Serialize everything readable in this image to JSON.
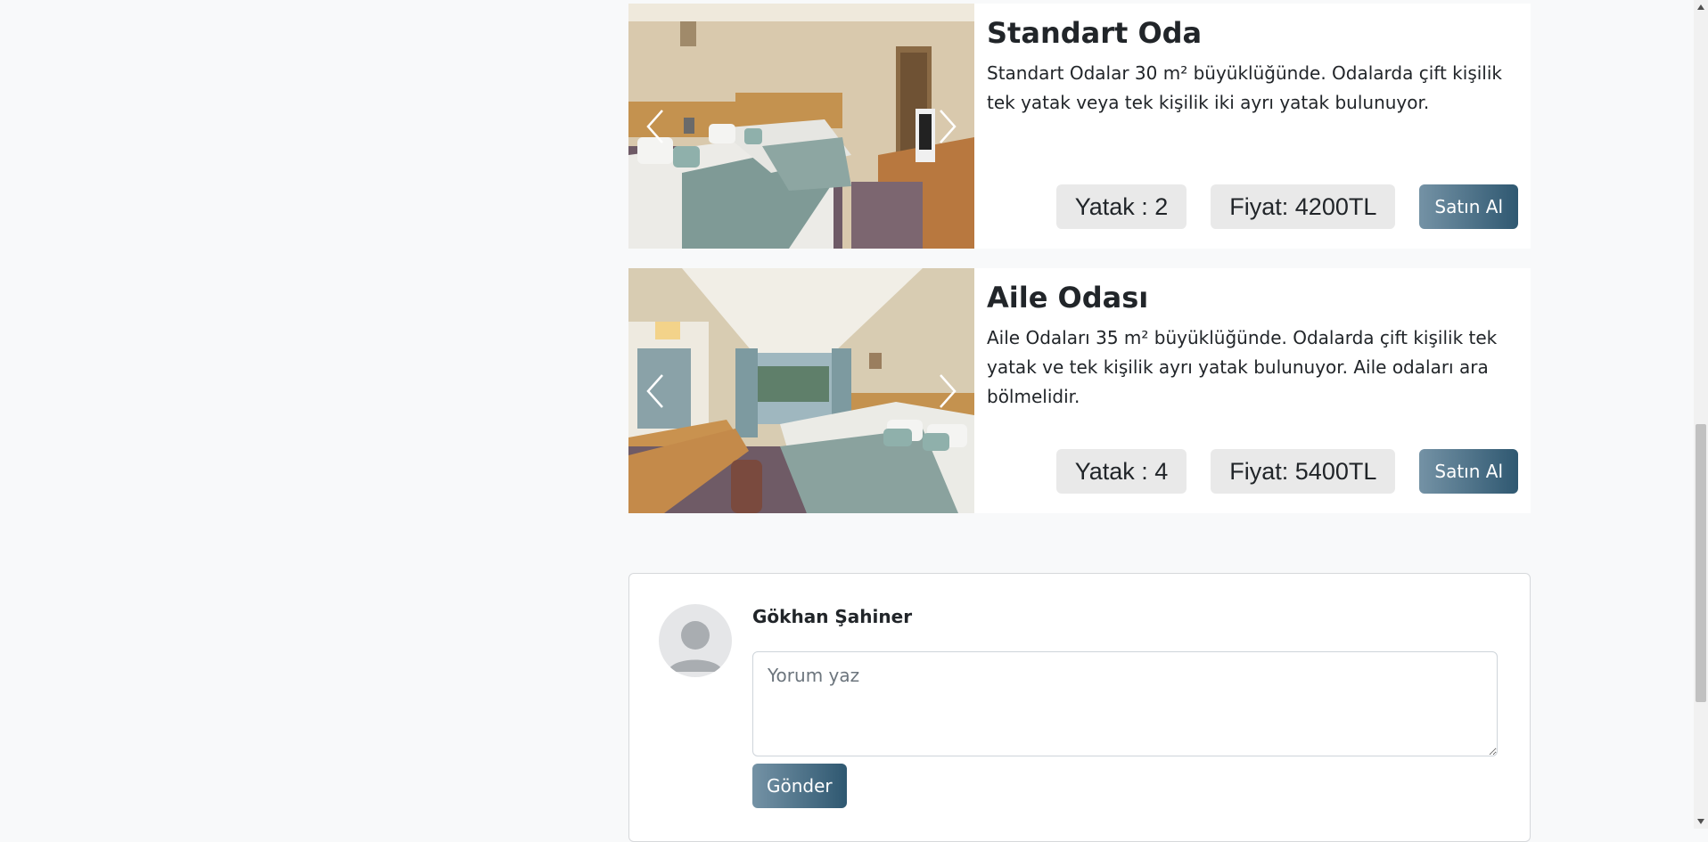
{
  "rooms": [
    {
      "title": "Standart Oda",
      "description": "Standart Odalar 30 m² büyüklüğünde. Odalarda çift kişilik tek yatak veya tek kişilik iki ayrı yatak bulunuyor.",
      "beds": "Yatak : 2",
      "price": "Fiyat: 4200TL",
      "buy_label": "Satın Al",
      "image": "hotel-room-twin-beds-photo"
    },
    {
      "title": "Aile Odası",
      "description": "Aile Odaları 35 m² büyüklüğünde. Odalarda çift kişilik tek yatak ve tek kişilik ayrı yatak bulunuyor. Aile odaları ara bölmelidir.",
      "beds": "Yatak : 4",
      "price": "Fiyat: 5400TL",
      "buy_label": "Satın Al",
      "image": "hotel-family-room-photo"
    }
  ],
  "comment": {
    "user_name": "Gökhan Şahiner",
    "placeholder": "Yorum yaz",
    "value": "",
    "send_label": "Gönder",
    "avatar_icon": "user-avatar-icon"
  },
  "colors": {
    "page_bg": "#f8f9fa",
    "chip_bg": "#e9e9e9",
    "button_gradient_start": "#7492a5",
    "button_gradient_end": "#2f5871"
  },
  "icons": {
    "carousel_prev": "chevron-left-icon",
    "carousel_next": "chevron-right-icon"
  }
}
